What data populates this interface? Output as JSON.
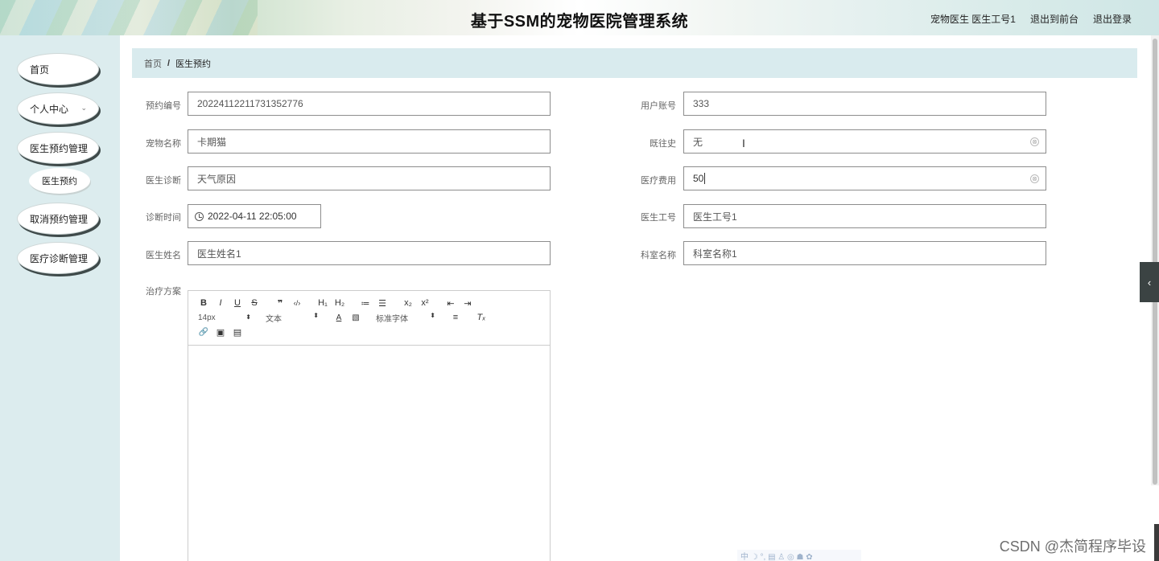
{
  "header": {
    "title": "基于SSM的宠物医院管理系统",
    "user": "宠物医生 医生工号1",
    "front_link": "退出到前台",
    "logout": "退出登录"
  },
  "sidebar": {
    "items": [
      {
        "label": "首页"
      },
      {
        "label": "个人中心",
        "chevron": "⌄"
      },
      {
        "label": "医生预约管理"
      },
      {
        "label": "医生预约"
      },
      {
        "label": "取消预约管理"
      },
      {
        "label": "医疗诊断管理"
      }
    ]
  },
  "breadcrumb": {
    "home": "首页",
    "separator": "/",
    "current": "医生预约"
  },
  "form": {
    "booking_no": {
      "label": "预约编号",
      "value": "20224112211731352776"
    },
    "user_account": {
      "label": "用户账号",
      "value": "333"
    },
    "pet_name": {
      "label": "宠物名称",
      "value": "卡期猫"
    },
    "history": {
      "label": "既往史",
      "value": "无"
    },
    "diagnosis": {
      "label": "医生诊断",
      "value": "天气原因"
    },
    "fee": {
      "label": "医疗费用",
      "value": "50"
    },
    "diag_time": {
      "label": "诊断时间",
      "value": "2022-04-11 22:05:00"
    },
    "doctor_no": {
      "label": "医生工号",
      "value": "医生工号1"
    },
    "doctor_name": {
      "label": "医生姓名",
      "value": "医生姓名1"
    },
    "dept_name": {
      "label": "科室名称",
      "value": "科室名称1"
    },
    "plan": {
      "label": "治疗方案"
    }
  },
  "editor": {
    "row1": [
      "B",
      "I",
      "U",
      "S",
      "❞",
      "‹/›",
      "H₁",
      "H₂",
      "≔",
      "☰",
      "x₂",
      "x²",
      "⇤",
      "⇥"
    ],
    "size_select": "14px",
    "block_select": "文本",
    "font_select": "标准字体",
    "row2_icons": [
      "A",
      "▧",
      "≡",
      "Tₓ"
    ],
    "row3": [
      "🔗",
      "▣",
      "▤"
    ]
  },
  "icons": {
    "clear": "⊗",
    "toggle": "‹",
    "ibeam": "I"
  },
  "watermark": "CSDN @杰简程序毕设",
  "ime": "中 ☽ °, ▤ ♙ ◎ ☗ ✿"
}
